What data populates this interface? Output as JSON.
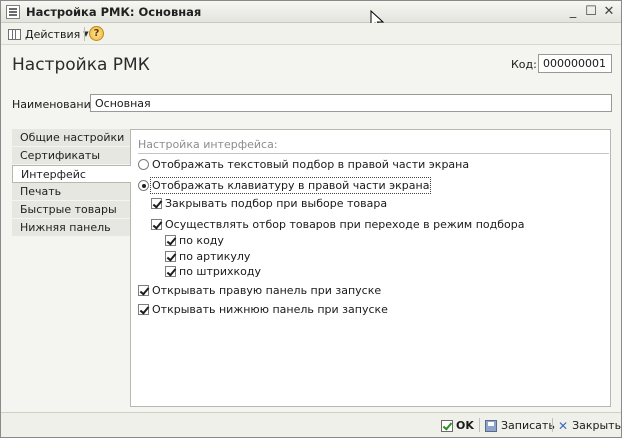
{
  "window": {
    "title": "Настройка РМК: Основная",
    "controls": {
      "minimize": "_",
      "maximize": "☐",
      "close": "✕"
    }
  },
  "toolbar": {
    "actions_label": "Действия",
    "help_label": "?"
  },
  "form": {
    "title": "Настройка РМК",
    "code_label": "Код:",
    "code_value": "000000001",
    "name_label": "Наименование:",
    "name_value": "Основная"
  },
  "nav": {
    "items": [
      {
        "label": "Общие настройки",
        "active": false
      },
      {
        "label": "Сертификаты",
        "active": false
      },
      {
        "label": "Интерфейс",
        "active": true
      },
      {
        "label": "Печать",
        "active": false
      },
      {
        "label": "Быстрые товары",
        "active": false
      },
      {
        "label": "Нижняя панель",
        "active": false
      }
    ]
  },
  "interface": {
    "heading": "Настройка интерфейса:",
    "options": {
      "text_selection": {
        "label": "Отображать текстовый подбор в правой части экрана",
        "checked": false
      },
      "keyboard": {
        "label": "Отображать клавиатуру в правой части экрана",
        "checked": true
      },
      "close_on_select": {
        "label": "Закрывать подбор при выборе товара",
        "checked": true
      },
      "filter_on_select": {
        "label": "Осуществлять отбор товаров при переходе в режим подбора",
        "checked": true
      },
      "by_code": {
        "label": "по коду",
        "checked": true
      },
      "by_article": {
        "label": "по артикулу",
        "checked": true
      },
      "by_barcode": {
        "label": "по штрихкоду",
        "checked": true
      },
      "open_right_panel": {
        "label": "Открывать правую панель при запуске",
        "checked": true
      },
      "open_bottom_panel": {
        "label": "Открывать нижнюю панель при запуске",
        "checked": true
      }
    }
  },
  "bottombar": {
    "ok_label": "OK",
    "save_label": "Записать",
    "close_label": "Закрыть"
  },
  "colors": {
    "accent_blue": "#3b6bbf",
    "ok_green": "#2d8f1e",
    "heading_gray": "#8d8d8d"
  }
}
